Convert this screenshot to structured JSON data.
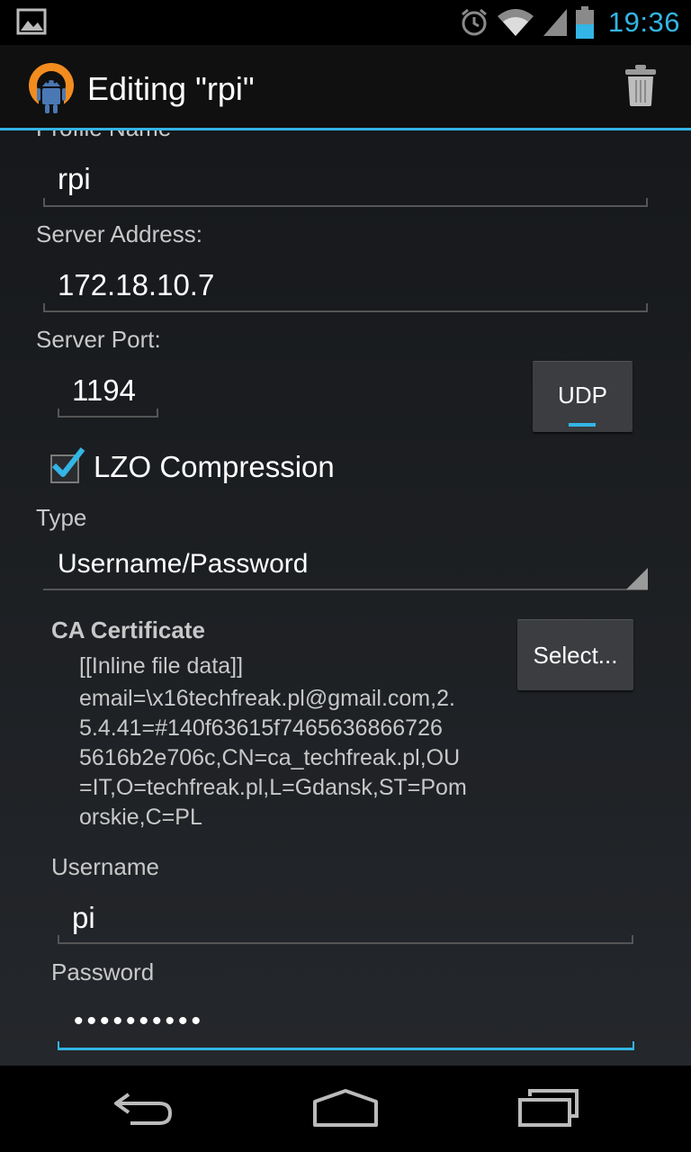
{
  "status_bar": {
    "time": "19:36",
    "icons": [
      "image-notification-icon",
      "alarm-icon",
      "wifi-icon",
      "signal-icon",
      "battery-icon"
    ],
    "accent_color": "#33b5e5"
  },
  "action_bar": {
    "title": "Editing \"rpi\"",
    "icons": [
      "openvpn-app-icon",
      "trash-icon"
    ]
  },
  "form": {
    "profile_name": {
      "label": "Profile Name",
      "value": "rpi"
    },
    "server_address": {
      "label": "Server Address:",
      "value": "172.18.10.7"
    },
    "server_port": {
      "label": "Server Port:",
      "value": "1194"
    },
    "protocol_button": {
      "label": "UDP"
    },
    "lzo": {
      "label": "LZO Compression",
      "checked": true
    },
    "type": {
      "label": "Type",
      "value": "Username/Password"
    },
    "ca_certificate": {
      "label": "CA Certificate",
      "lines": [
        "[[Inline file data]]",
        "email=\\x16techfreak.pl@gmail.com,2.",
        "5.4.41=#140f63615f7465636866726",
        "5616b2e706c,CN=ca_techfreak.pl,OU",
        "=IT,O=techfreak.pl,L=Gdansk,ST=Pom",
        "orskie,C=PL"
      ],
      "select_button": "Select..."
    },
    "username": {
      "label": "Username",
      "value": "pi"
    },
    "password": {
      "label": "Password",
      "value": "••••••••••"
    }
  },
  "nav_bar": {
    "icons": [
      "back-icon",
      "home-icon",
      "recent-apps-icon"
    ]
  }
}
